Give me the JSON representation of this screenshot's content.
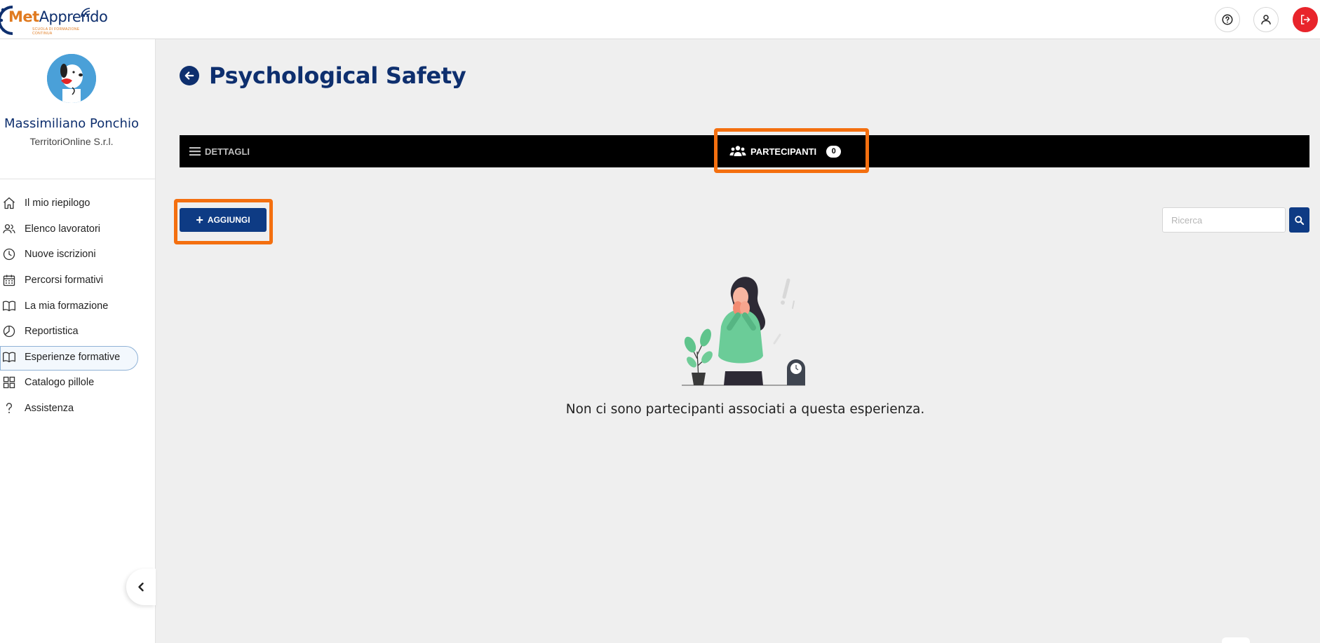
{
  "app": {
    "logo_met": "Met",
    "logo_apprendo": "Apprendo",
    "logo_tagline": "SCUOLA DI FORMAZIONE CONTINUA"
  },
  "topbar": {
    "icons": [
      "help-icon",
      "user-icon",
      "logout-icon"
    ],
    "logout_color": "#e8242b"
  },
  "user": {
    "name": "Massimiliano Ponchio",
    "company": "TerritoriOnline S.r.l."
  },
  "sidebar": {
    "items": [
      {
        "label": "Il mio riepilogo",
        "icon": "home-icon"
      },
      {
        "label": "Elenco lavoratori",
        "icon": "users-icon"
      },
      {
        "label": "Nuove iscrizioni",
        "icon": "clock-icon"
      },
      {
        "label": "Percorsi formativi",
        "icon": "calendar-icon"
      },
      {
        "label": "La mia formazione",
        "icon": "book-icon"
      },
      {
        "label": "Reportistica",
        "icon": "pie-chart-icon"
      },
      {
        "label": "Esperienze formative",
        "icon": "book-open-icon",
        "active": true
      },
      {
        "label": "Catalogo pillole",
        "icon": "grid-icon"
      },
      {
        "label": "Assistenza",
        "icon": "question-icon"
      }
    ]
  },
  "page": {
    "title": "Psychological Safety"
  },
  "tabs": {
    "dettagli": "DETTAGLI",
    "partecipanti": "PARTECIPANTI",
    "partecipanti_count": "0"
  },
  "toolbar": {
    "add_label": "AGGIUNGI",
    "search_placeholder": "Ricerca"
  },
  "empty_state": {
    "message": "Non ci sono partecipanti associati a questa esperienza."
  },
  "colors": {
    "brand_navy": "#0e2f6e",
    "button_blue": "#0e3b84",
    "highlight_orange": "#f46f0f",
    "brand_orange": "#e07a1f"
  }
}
